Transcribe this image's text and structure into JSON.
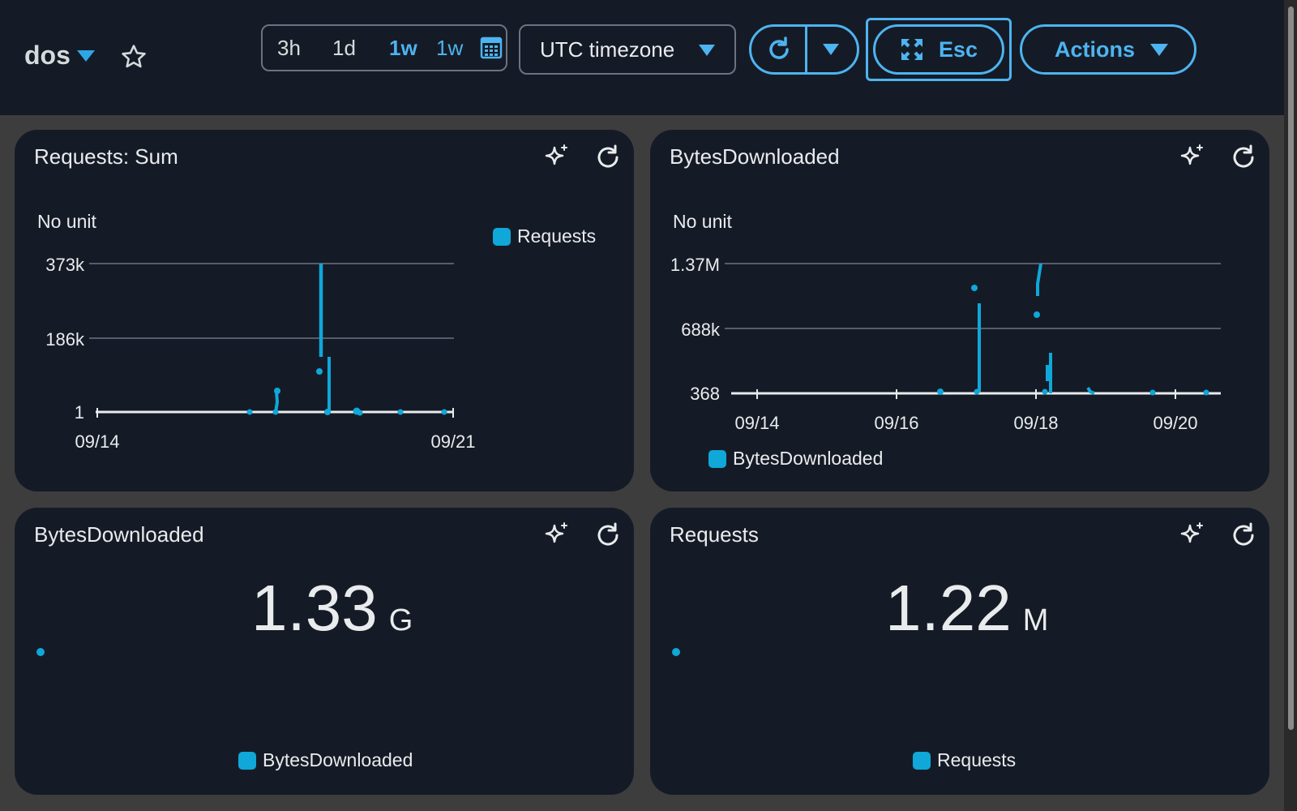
{
  "header": {
    "dashboard_name": "dos",
    "time_ranges": [
      "3h",
      "1d",
      "1w",
      "1w"
    ],
    "timezone": "UTC timezone",
    "esc_label": "Esc",
    "actions_label": "Actions"
  },
  "widgets": [
    {
      "title": "Requests: Sum",
      "unit": "No unit",
      "legend": "Requests"
    },
    {
      "title": "BytesDownloaded",
      "unit": "No unit",
      "legend": "BytesDownloaded"
    },
    {
      "title": "BytesDownloaded",
      "value": "1.33",
      "suffix": "G",
      "legend": "BytesDownloaded"
    },
    {
      "title": "Requests",
      "value": "1.22",
      "suffix": "M",
      "legend": "Requests"
    }
  ],
  "colors": {
    "series": "#10a7d9",
    "accent": "#4db4f0"
  },
  "chart_data": [
    {
      "type": "line",
      "title": "Requests: Sum",
      "ylabel": "No unit",
      "series": [
        {
          "name": "Requests",
          "values": [
            [
              0.0,
              1
            ],
            [
              3.0,
              1
            ],
            [
              3.5,
              1
            ],
            [
              3.6,
              40000
            ],
            [
              3.7,
              373000
            ],
            [
              3.78,
              142000
            ],
            [
              4.1,
              1
            ],
            [
              4.5,
              1
            ],
            [
              5.0,
              1
            ],
            [
              6.8,
              1
            ]
          ]
        }
      ],
      "x_ticks": [
        "09/14",
        "09/21"
      ],
      "y_ticks": [
        "1",
        "186k",
        "373k"
      ],
      "ylim": [
        1,
        373000
      ]
    },
    {
      "type": "line",
      "title": "BytesDownloaded",
      "ylabel": "No unit",
      "series": [
        {
          "name": "BytesDownloaded",
          "values": [
            [
              0.0,
              368
            ],
            [
              2.6,
              368
            ],
            [
              3.2,
              1200000
            ],
            [
              3.2,
              368
            ],
            [
              4.0,
              1370000
            ],
            [
              4.0,
              1150000
            ],
            [
              4.05,
              368
            ],
            [
              4.1,
              830000
            ],
            [
              4.12,
              368
            ],
            [
              4.8,
              368
            ],
            [
              5.6,
              368
            ],
            [
              6.4,
              368
            ]
          ]
        }
      ],
      "x_ticks": [
        "09/14",
        "09/16",
        "09/18",
        "09/20"
      ],
      "y_ticks": [
        "368",
        "688k",
        "1.37M"
      ],
      "ylim": [
        368,
        1370000
      ]
    }
  ]
}
